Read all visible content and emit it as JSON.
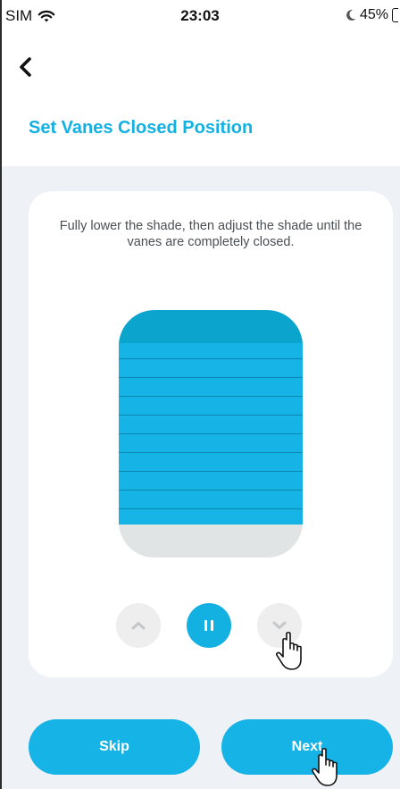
{
  "status_bar": {
    "carrier": "SIM",
    "time": "23:03",
    "battery": "45%",
    "icons": [
      "wifi-icon",
      "moon-icon",
      "battery-icon"
    ]
  },
  "header": {
    "back_icon": "chevron-left-icon",
    "title": "Set Vanes Closed Position"
  },
  "card": {
    "instruction": "Fully lower the shade, then adjust the shade until the vanes are completely closed.",
    "controls": [
      {
        "name": "raise",
        "icon": "chevron-up-icon",
        "active": false
      },
      {
        "name": "stop",
        "icon": "pause-icon",
        "active": true
      },
      {
        "name": "lower",
        "icon": "chevron-down-icon",
        "active": false
      }
    ]
  },
  "footer": {
    "skip_label": "Skip",
    "next_label": "Next"
  },
  "colors": {
    "accent": "#15b3e6",
    "headrail": "#0ba4cd",
    "background": "#eef1f5"
  }
}
